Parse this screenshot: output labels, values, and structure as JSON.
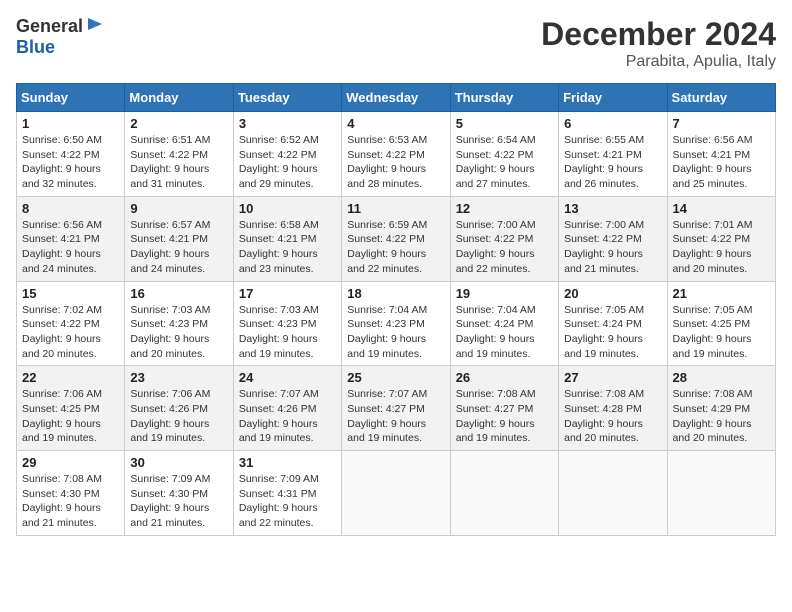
{
  "header": {
    "logo_line1": "General",
    "logo_line2": "Blue",
    "title": "December 2024",
    "subtitle": "Parabita, Apulia, Italy"
  },
  "calendar": {
    "weekdays": [
      "Sunday",
      "Monday",
      "Tuesday",
      "Wednesday",
      "Thursday",
      "Friday",
      "Saturday"
    ],
    "weeks": [
      [
        {
          "day": "1",
          "info": "Sunrise: 6:50 AM\nSunset: 4:22 PM\nDaylight: 9 hours\nand 32 minutes."
        },
        {
          "day": "2",
          "info": "Sunrise: 6:51 AM\nSunset: 4:22 PM\nDaylight: 9 hours\nand 31 minutes."
        },
        {
          "day": "3",
          "info": "Sunrise: 6:52 AM\nSunset: 4:22 PM\nDaylight: 9 hours\nand 29 minutes."
        },
        {
          "day": "4",
          "info": "Sunrise: 6:53 AM\nSunset: 4:22 PM\nDaylight: 9 hours\nand 28 minutes."
        },
        {
          "day": "5",
          "info": "Sunrise: 6:54 AM\nSunset: 4:22 PM\nDaylight: 9 hours\nand 27 minutes."
        },
        {
          "day": "6",
          "info": "Sunrise: 6:55 AM\nSunset: 4:21 PM\nDaylight: 9 hours\nand 26 minutes."
        },
        {
          "day": "7",
          "info": "Sunrise: 6:56 AM\nSunset: 4:21 PM\nDaylight: 9 hours\nand 25 minutes."
        }
      ],
      [
        {
          "day": "8",
          "info": "Sunrise: 6:56 AM\nSunset: 4:21 PM\nDaylight: 9 hours\nand 24 minutes."
        },
        {
          "day": "9",
          "info": "Sunrise: 6:57 AM\nSunset: 4:21 PM\nDaylight: 9 hours\nand 24 minutes."
        },
        {
          "day": "10",
          "info": "Sunrise: 6:58 AM\nSunset: 4:21 PM\nDaylight: 9 hours\nand 23 minutes."
        },
        {
          "day": "11",
          "info": "Sunrise: 6:59 AM\nSunset: 4:22 PM\nDaylight: 9 hours\nand 22 minutes."
        },
        {
          "day": "12",
          "info": "Sunrise: 7:00 AM\nSunset: 4:22 PM\nDaylight: 9 hours\nand 22 minutes."
        },
        {
          "day": "13",
          "info": "Sunrise: 7:00 AM\nSunset: 4:22 PM\nDaylight: 9 hours\nand 21 minutes."
        },
        {
          "day": "14",
          "info": "Sunrise: 7:01 AM\nSunset: 4:22 PM\nDaylight: 9 hours\nand 20 minutes."
        }
      ],
      [
        {
          "day": "15",
          "info": "Sunrise: 7:02 AM\nSunset: 4:22 PM\nDaylight: 9 hours\nand 20 minutes."
        },
        {
          "day": "16",
          "info": "Sunrise: 7:03 AM\nSunset: 4:23 PM\nDaylight: 9 hours\nand 20 minutes."
        },
        {
          "day": "17",
          "info": "Sunrise: 7:03 AM\nSunset: 4:23 PM\nDaylight: 9 hours\nand 19 minutes."
        },
        {
          "day": "18",
          "info": "Sunrise: 7:04 AM\nSunset: 4:23 PM\nDaylight: 9 hours\nand 19 minutes."
        },
        {
          "day": "19",
          "info": "Sunrise: 7:04 AM\nSunset: 4:24 PM\nDaylight: 9 hours\nand 19 minutes."
        },
        {
          "day": "20",
          "info": "Sunrise: 7:05 AM\nSunset: 4:24 PM\nDaylight: 9 hours\nand 19 minutes."
        },
        {
          "day": "21",
          "info": "Sunrise: 7:05 AM\nSunset: 4:25 PM\nDaylight: 9 hours\nand 19 minutes."
        }
      ],
      [
        {
          "day": "22",
          "info": "Sunrise: 7:06 AM\nSunset: 4:25 PM\nDaylight: 9 hours\nand 19 minutes."
        },
        {
          "day": "23",
          "info": "Sunrise: 7:06 AM\nSunset: 4:26 PM\nDaylight: 9 hours\nand 19 minutes."
        },
        {
          "day": "24",
          "info": "Sunrise: 7:07 AM\nSunset: 4:26 PM\nDaylight: 9 hours\nand 19 minutes."
        },
        {
          "day": "25",
          "info": "Sunrise: 7:07 AM\nSunset: 4:27 PM\nDaylight: 9 hours\nand 19 minutes."
        },
        {
          "day": "26",
          "info": "Sunrise: 7:08 AM\nSunset: 4:27 PM\nDaylight: 9 hours\nand 19 minutes."
        },
        {
          "day": "27",
          "info": "Sunrise: 7:08 AM\nSunset: 4:28 PM\nDaylight: 9 hours\nand 20 minutes."
        },
        {
          "day": "28",
          "info": "Sunrise: 7:08 AM\nSunset: 4:29 PM\nDaylight: 9 hours\nand 20 minutes."
        }
      ],
      [
        {
          "day": "29",
          "info": "Sunrise: 7:08 AM\nSunset: 4:30 PM\nDaylight: 9 hours\nand 21 minutes."
        },
        {
          "day": "30",
          "info": "Sunrise: 7:09 AM\nSunset: 4:30 PM\nDaylight: 9 hours\nand 21 minutes."
        },
        {
          "day": "31",
          "info": "Sunrise: 7:09 AM\nSunset: 4:31 PM\nDaylight: 9 hours\nand 22 minutes."
        },
        null,
        null,
        null,
        null
      ]
    ]
  }
}
